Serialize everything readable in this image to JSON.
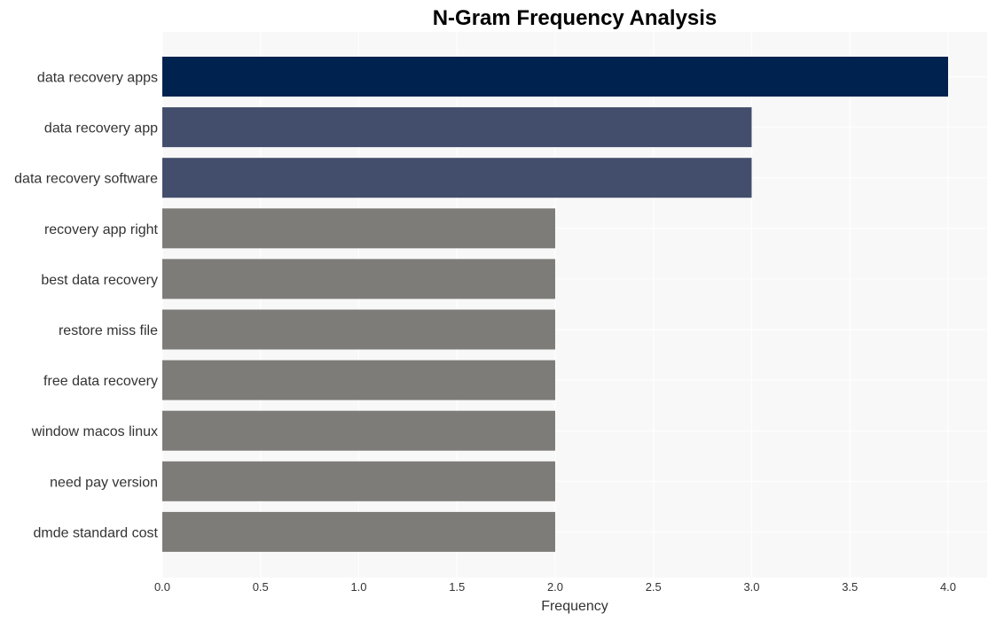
{
  "chart_data": {
    "type": "bar",
    "orientation": "horizontal",
    "title": "N-Gram Frequency Analysis",
    "xlabel": "Frequency",
    "ylabel": "",
    "xlim": [
      0,
      4.2
    ],
    "xticks": [
      0.0,
      0.5,
      1.0,
      1.5,
      2.0,
      2.5,
      3.0,
      3.5,
      4.0
    ],
    "xtick_labels": [
      "0.0",
      "0.5",
      "1.0",
      "1.5",
      "2.0",
      "2.5",
      "3.0",
      "3.5",
      "4.0"
    ],
    "grid": true,
    "categories": [
      "data recovery apps",
      "data recovery app",
      "data recovery software",
      "recovery app right",
      "best data recovery",
      "restore miss file",
      "free data recovery",
      "window macos linux",
      "need pay version",
      "dmde standard cost"
    ],
    "values": [
      4,
      3,
      3,
      2,
      2,
      2,
      2,
      2,
      2,
      2
    ],
    "colors": {
      "4": "#00224e",
      "3": "#434e6c",
      "2": "#7d7c78"
    },
    "plot_background": "#f8f8f8",
    "gridline_color": "#ffffff"
  }
}
